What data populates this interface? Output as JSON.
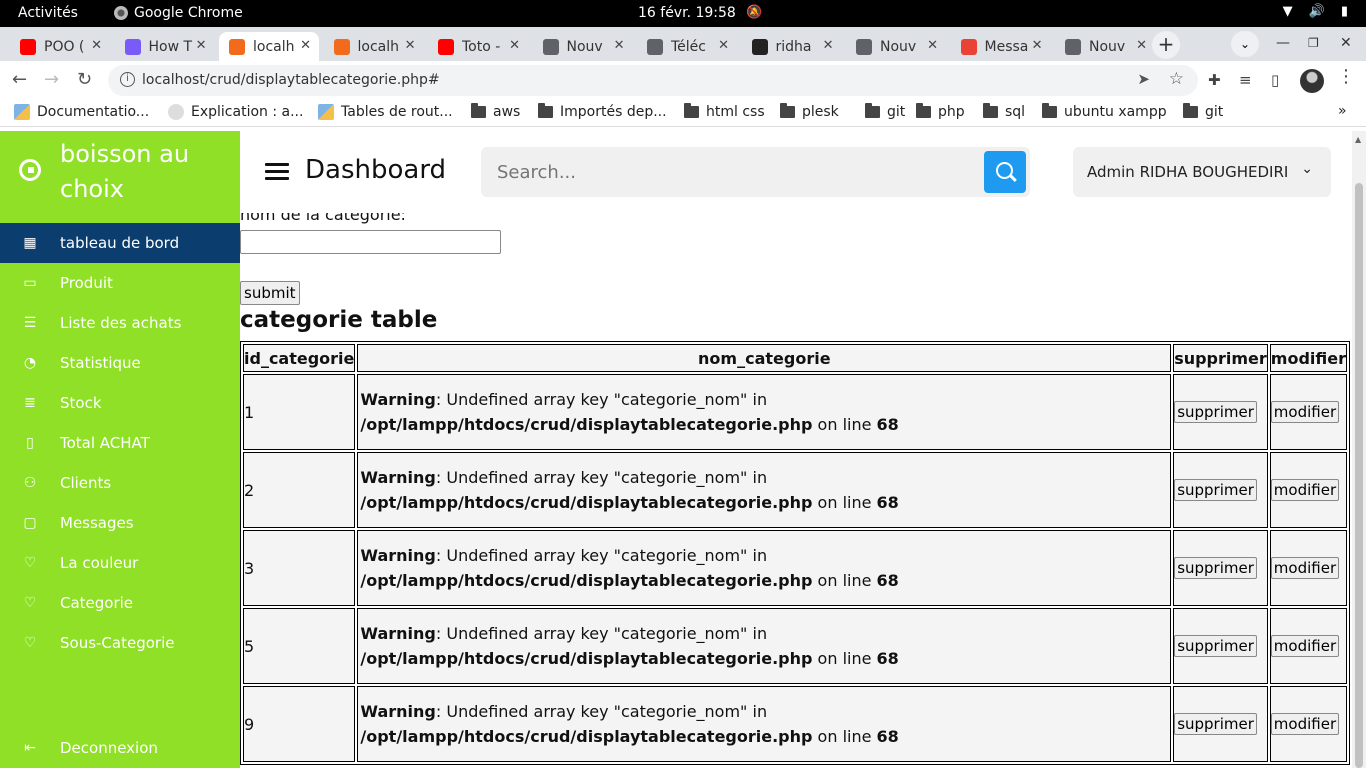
{
  "os": {
    "activities": "Activités",
    "app_name": "Google Chrome",
    "datetime": "16 févr.  19:58"
  },
  "tabs": [
    {
      "title": "POO (",
      "color": "#ff0000"
    },
    {
      "title": "How T",
      "color": "#7a5af8"
    },
    {
      "title": "localh",
      "color": "#f26b1d",
      "active": true
    },
    {
      "title": "localh",
      "color": "#f26b1d"
    },
    {
      "title": "Toto -",
      "color": "#ff0000"
    },
    {
      "title": "Nouv",
      "color": "#5f6368"
    },
    {
      "title": "Téléc",
      "color": "#5f6368"
    },
    {
      "title": "ridha",
      "color": "#222222"
    },
    {
      "title": "Nouv",
      "color": "#5f6368"
    },
    {
      "title": "Messa",
      "color": "#ea4335"
    },
    {
      "title": "Nouv",
      "color": "#5f6368"
    }
  ],
  "address_bar": {
    "url": "localhost/crud/displaytablecategorie.php#"
  },
  "bookmarks": [
    {
      "label": "Documentatio...",
      "icon": "cube-icon"
    },
    {
      "label": "Explication : a...",
      "icon": "site-icon"
    },
    {
      "label": "Tables de rout...",
      "icon": "cube-icon"
    },
    {
      "label": "aws",
      "icon": "folder-icon"
    },
    {
      "label": "Importés dep...",
      "icon": "folder-icon"
    },
    {
      "label": "html css",
      "icon": "folder-icon"
    },
    {
      "label": "plesk",
      "icon": "folder-icon"
    },
    {
      "label": "git",
      "icon": "folder-icon"
    },
    {
      "label": "php",
      "icon": "folder-icon"
    },
    {
      "label": "sql",
      "icon": "folder-icon"
    },
    {
      "label": "ubuntu xampp",
      "icon": "folder-icon"
    },
    {
      "label": "git",
      "icon": "folder-icon"
    }
  ],
  "colors": {
    "sidebar": "#8fe026",
    "active_item": "#0b3d6e",
    "search_button": "#1e9bf0"
  },
  "sidebar": {
    "brand": "boisson au choix",
    "items": [
      {
        "label": "tableau de bord",
        "icon": "grid-icon",
        "active": true
      },
      {
        "label": "Produit",
        "icon": "box-icon"
      },
      {
        "label": "Liste des achats",
        "icon": "list-icon"
      },
      {
        "label": "Statistique",
        "icon": "pie-icon"
      },
      {
        "label": "Stock",
        "icon": "database-icon"
      },
      {
        "label": "Total ACHAT",
        "icon": "book-icon"
      },
      {
        "label": "Clients",
        "icon": "user-icon"
      },
      {
        "label": "Messages",
        "icon": "message-icon"
      },
      {
        "label": "La couleur",
        "icon": "heart-icon"
      },
      {
        "label": "Categorie",
        "icon": "heart-icon"
      },
      {
        "label": "Sous-Categorie",
        "icon": "heart-icon"
      }
    ],
    "logout": "Deconnexion"
  },
  "header": {
    "title": "Dashboard",
    "search_placeholder": "Search...",
    "user": "Admin RIDHA BOUGHEDIRI"
  },
  "form": {
    "label": "nom de la categorie:",
    "submit": "submit"
  },
  "table": {
    "title": "categorie table",
    "columns": [
      "id_categorie",
      "nom_categorie",
      "supprimer",
      "modifier"
    ],
    "warning": {
      "prefix": "Warning",
      "message": ": Undefined array key \"categorie_nom\" in",
      "path": "/opt/lampp/htdocs/crud/displaytablecategorie.php",
      "line_text": " on line ",
      "line": "68"
    },
    "delete_label": "supprimer",
    "edit_label": "modifier",
    "rows": [
      {
        "id": "1"
      },
      {
        "id": "2"
      },
      {
        "id": "3"
      },
      {
        "id": "5"
      },
      {
        "id": "9"
      }
    ]
  }
}
